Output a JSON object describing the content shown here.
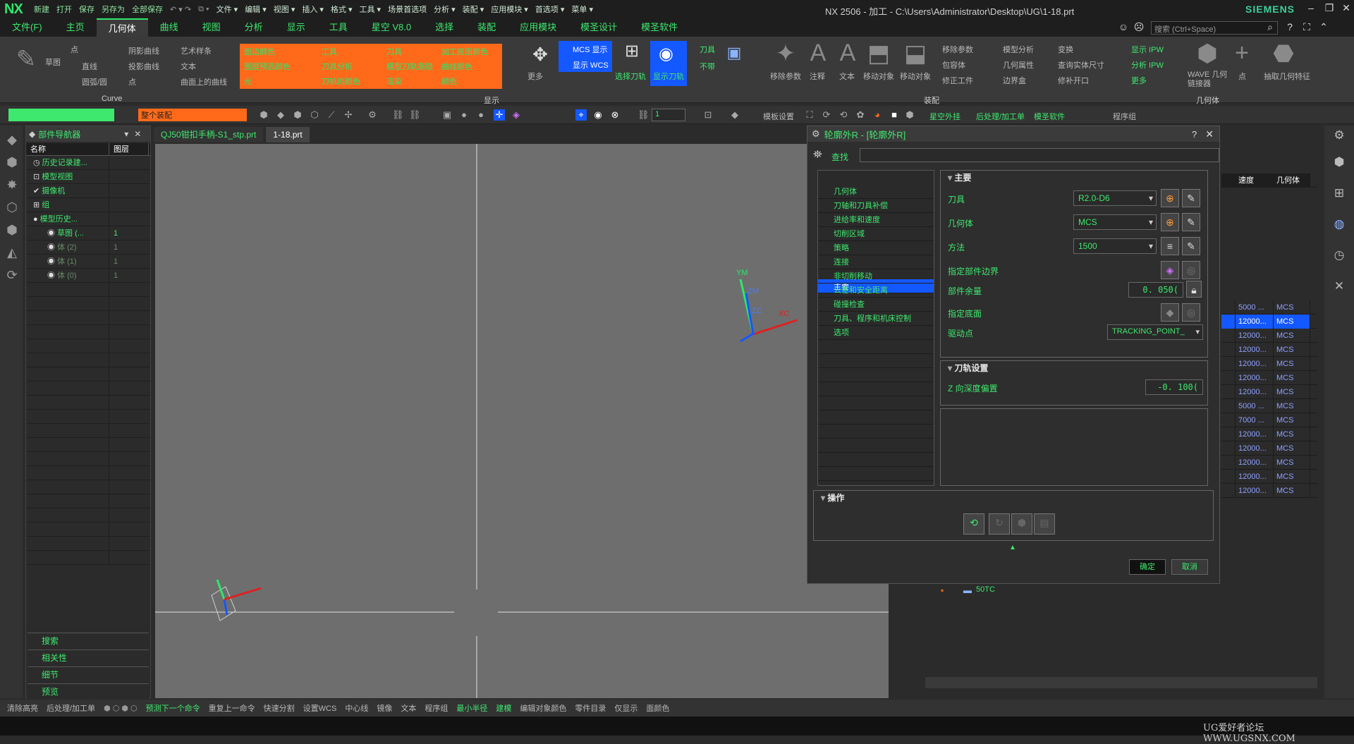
{
  "titlebar": {
    "logo": "NX",
    "quick": [
      "新建",
      "打开",
      "保存",
      "另存为",
      "全部保存"
    ],
    "menus": [
      "文件 ▾",
      "编辑 ▾",
      "视图 ▾",
      "插入 ▾",
      "格式 ▾",
      "工具 ▾",
      "场景首选项",
      "分析 ▾",
      "装配 ▾",
      "应用模块 ▾",
      "首选项 ▾",
      "菜单 ▾"
    ],
    "window_title": "NX 2506 - 加工 - C:\\Users\\Administrator\\Desktop\\UG\\1-18.prt",
    "brand": "SIEMENS"
  },
  "tabs": [
    "文件(F)",
    "主页",
    "几何体",
    "曲线",
    "视图",
    "分析",
    "显示",
    "工具",
    "星空 V8.0",
    "选择",
    "装配",
    "应用模块",
    "模圣设计",
    "模圣软件"
  ],
  "active_tab": "几何体",
  "search": {
    "placeholder": "搜索 (Ctrl+Space)"
  },
  "ribbon": {
    "curve": {
      "items": [
        "草图",
        "点",
        "直线",
        "圆弧/圆",
        "阴影曲线",
        "投影曲线",
        "点",
        "艺术样条",
        "文本",
        "曲面上的曲线"
      ],
      "group": "Curve"
    },
    "orange": [
      "面边颜色",
      "工具",
      "刀具",
      "加工底面颜色",
      "图层预选颜色",
      "刀具分析",
      "模型刀轨渐隐",
      "曲线颜色",
      "光",
      "刀轨的颜色",
      "渲染",
      "颜色"
    ],
    "display_group": "显示",
    "more": "更多",
    "mcs": {
      "mcs": "MCS 显示",
      "wcs": "显示 WCS"
    },
    "select_path": "选择刀轨",
    "show_path": "显示刀轨",
    "tool": "刀具",
    "normal": "不带",
    "assembly": [
      "移除参数",
      "注释",
      "文本",
      "移动对象",
      "移动对象",
      "移除参数",
      "包容体",
      "修正工件",
      "模型分析",
      "几何属性",
      "边界盒",
      "变换",
      "查询实体尺寸",
      "修补开口"
    ],
    "assembly_group": "装配",
    "geometry": [
      "显示 IPW",
      "分析 IPW",
      "更多",
      "WAVE 几何链接器",
      "点",
      "抽取几何特征"
    ],
    "geometry_group": "几何体"
  },
  "toolbar2": {
    "filter": "",
    "assembly_scope": "整个装配",
    "layer": "1",
    "items": [
      "模板设置",
      "星空外挂",
      "后处理/加工单",
      "模圣软件",
      "程序组"
    ]
  },
  "navigator": {
    "title": "部件导航器",
    "columns": [
      "名称",
      "图层"
    ],
    "rows": [
      {
        "name": "历史记录建...",
        "layer": ""
      },
      {
        "name": "模型视图",
        "layer": ""
      },
      {
        "name": "摄像机",
        "layer": ""
      },
      {
        "name": "组",
        "layer": ""
      },
      {
        "name": "模型历史...",
        "layer": ""
      },
      {
        "name": "草图 (...",
        "layer": "1"
      },
      {
        "name": "体 (2)",
        "layer": "1"
      },
      {
        "name": "体 (1)",
        "layer": "1"
      },
      {
        "name": "体 (0)",
        "layer": "1"
      }
    ],
    "panels": [
      "搜索",
      "相关性",
      "细节",
      "预览"
    ]
  },
  "filetabs": [
    "QJ50钳扣手柄-S1_stp.prt",
    "1-18.prt"
  ],
  "viewport": {
    "axes": {
      "ym": "YM",
      "zm": "ZM",
      "zc": "ZC",
      "xc": "XC"
    }
  },
  "dialog": {
    "title": "轮廓外R - [轮廓外R]",
    "find_label": "查找",
    "tree": [
      "主要",
      "几何体",
      "刀轴和刀具补偿",
      "进给率和速度",
      "切削区域",
      "策略",
      "连接",
      "非切削移动",
      "公差和安全距离",
      "碰撞检查",
      "刀具、程序和机床控制",
      "选项"
    ],
    "selected_tree": "主要",
    "main": {
      "title": "主要",
      "tool_label": "刀具",
      "tool_value": "R2.0-D6",
      "geometry_label": "几何体",
      "geometry_value": "MCS",
      "method_label": "方法",
      "method_value": "1500",
      "boundary_label": "指定部件边界",
      "stock_label": "部件余量",
      "stock_value": "0. 050(",
      "floor_label": "指定底面",
      "drive_label": "驱动点",
      "drive_value": "TRACKING_POINT_"
    },
    "toolpath": {
      "title": "刀轨设置",
      "z_label": "Z 向深度偏置",
      "z_value": "-0. 100("
    },
    "operation": {
      "title": "操作"
    },
    "ok": "确定",
    "cancel": "取消"
  },
  "optable": {
    "columns": [
      "速度",
      "几何体"
    ],
    "rows": [
      {
        "speed": "5000 ...",
        "geom": "MCS",
        "sel": false
      },
      {
        "speed": "12000...",
        "geom": "MCS",
        "sel": true
      },
      {
        "speed": "12000...",
        "geom": "MCS",
        "sel": false
      },
      {
        "speed": "12000...",
        "geom": "MCS",
        "sel": false
      },
      {
        "speed": "12000...",
        "geom": "MCS",
        "sel": false
      },
      {
        "speed": "12000...",
        "geom": "MCS",
        "sel": false
      },
      {
        "speed": "12000...",
        "geom": "MCS",
        "sel": false
      },
      {
        "speed": "5000 ...",
        "geom": "MCS",
        "sel": false
      },
      {
        "speed": "7000 ...",
        "geom": "MCS",
        "sel": false
      },
      {
        "speed": "12000...",
        "geom": "MCS",
        "sel": false
      },
      {
        "speed": "12000...",
        "geom": "MCS",
        "sel": false
      },
      {
        "speed": "12000...",
        "geom": "MCS",
        "sel": false
      },
      {
        "speed": "12000...",
        "geom": "MCS",
        "sel": false
      },
      {
        "speed": "12000...",
        "geom": "MCS",
        "sel": false
      }
    ],
    "folder": "50TC"
  },
  "status": [
    "清除高亮",
    "后处理/加工单",
    "预测下一个命令",
    "重复上一命令",
    "快速分割",
    "设置WCS",
    "中心线",
    "镜像",
    "文本",
    "程序组",
    "最小半径",
    "建模",
    "编辑对象颜色",
    "零件目录",
    "仅显示",
    "面颜色"
  ],
  "watermark": "UG爱好者论坛 WWW.UGSNX.COM",
  "colors": {
    "accent": "#2ee66b",
    "selection": "#1458ff",
    "orange": "#ff6a1a",
    "bg": "#2b2b2b"
  }
}
